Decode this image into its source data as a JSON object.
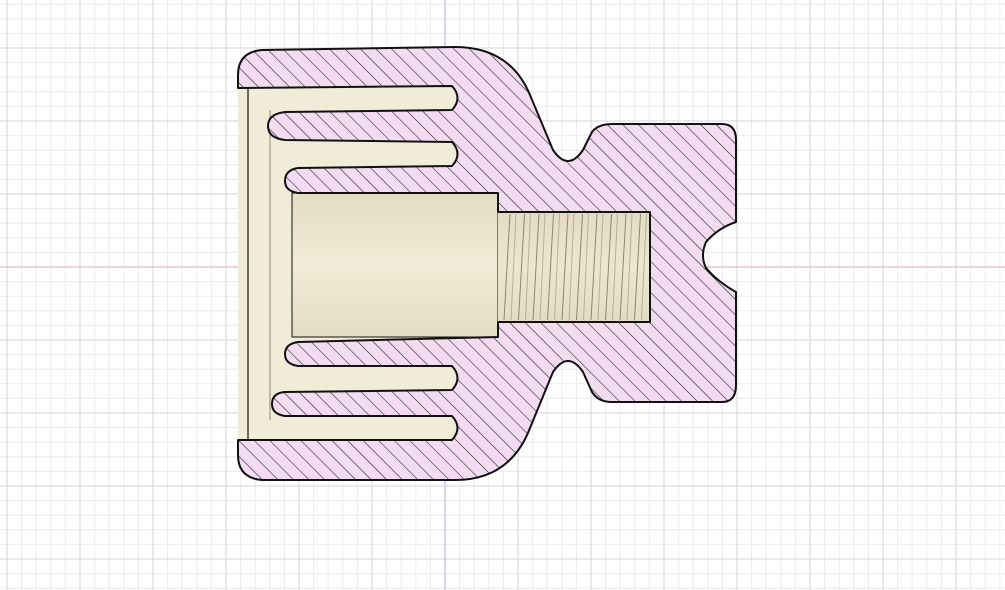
{
  "canvas": {
    "background_color": "#ffffff",
    "minor_grid_color": "#ececf0",
    "major_grid_color": "#d6d6dc",
    "x_axis_color": "#d8a8b0",
    "y_axis_color": "#a8b0dc"
  },
  "section_view": {
    "hatch_fill_color": "#f3dcf1",
    "hatch_line_color": "#1a1a1a",
    "outline_color": "#111111",
    "interior_face_color": "#f1ecd8",
    "interior_face_shade_color": "#e4dcc2",
    "thread_color": "#ede6cf",
    "thread_line_color": "#8c8672",
    "features": [
      "outer-body",
      "relief-grooves",
      "counterbore",
      "threaded-hole",
      "side-notch",
      "rear-slot"
    ]
  }
}
